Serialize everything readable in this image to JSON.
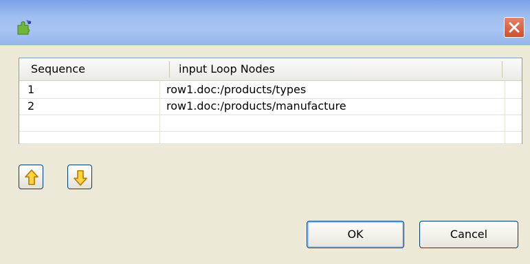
{
  "window": {
    "title": "",
    "close_icon": "close-icon",
    "app_icon": "puzzle-icon"
  },
  "table": {
    "columns": [
      "Sequence",
      "input Loop Nodes"
    ],
    "rows": [
      {
        "sequence": "1",
        "node": "row1.doc:/products/types"
      },
      {
        "sequence": "2",
        "node": "row1.doc:/products/manufacture"
      }
    ]
  },
  "controls": {
    "move_up_icon": "arrow-up-icon",
    "move_down_icon": "arrow-down-icon"
  },
  "buttons": {
    "ok": "OK",
    "cancel": "Cancel"
  },
  "colors": {
    "titlebar": "#a9c4f1",
    "close": "#cf4f2e",
    "dialog_bg": "#ece9d8",
    "button_border": "#003c74"
  }
}
